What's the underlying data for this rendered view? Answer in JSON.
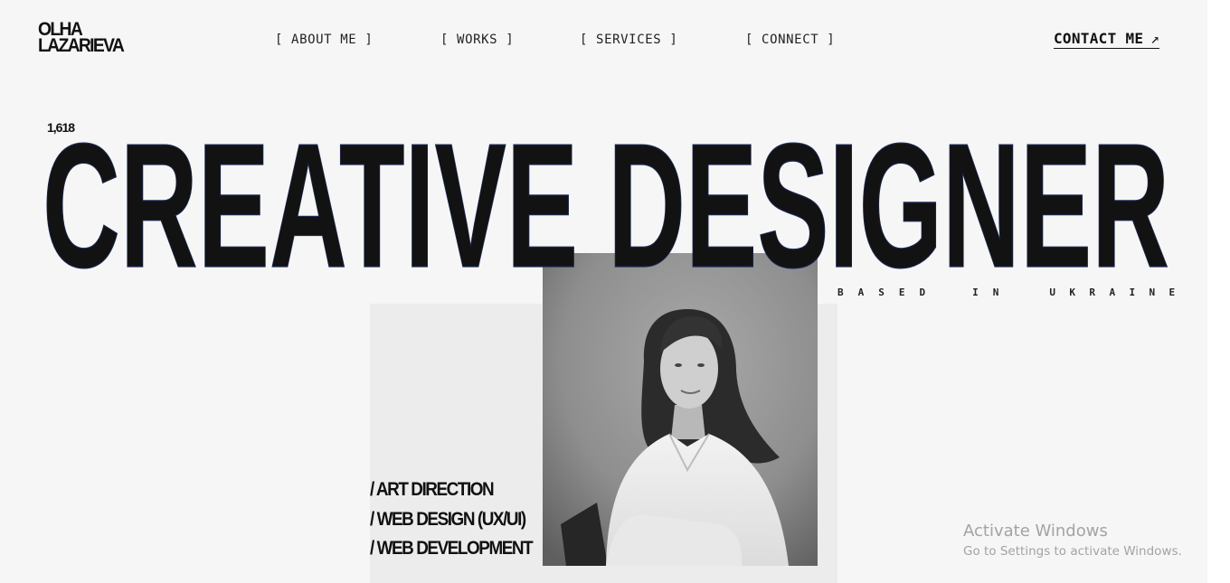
{
  "logo": {
    "line1": "OLHA",
    "line2": "LAZARIEVA"
  },
  "nav": {
    "about": "[ ABOUT ME ]",
    "works": "[ WORKS ]",
    "services": "[ SERVICES ]",
    "connect": "[ CONNECT ]"
  },
  "contact": {
    "label": "CONTACT ME",
    "icon": "arrow-up-right-icon",
    "arrow": "↗"
  },
  "hero": {
    "ratio": "1,618",
    "headline": "CREATIVE DESIGNER",
    "based_words": [
      "BASED",
      "IN",
      "UKRAINE"
    ]
  },
  "services": [
    "/ ART DIRECTION",
    "/ WEB DESIGN (UX/UI)",
    "/ WEB DEVELOPMENT"
  ],
  "photo": {
    "alt": "Black and white portrait of a woman in a white shirt"
  },
  "watermark": {
    "title": "Activate Windows",
    "subtitle": "Go to Settings to activate Windows."
  },
  "colors": {
    "background": "#f6f6f6",
    "text": "#111111",
    "frame": "#ececec",
    "watermark": "#a3a3a3"
  }
}
